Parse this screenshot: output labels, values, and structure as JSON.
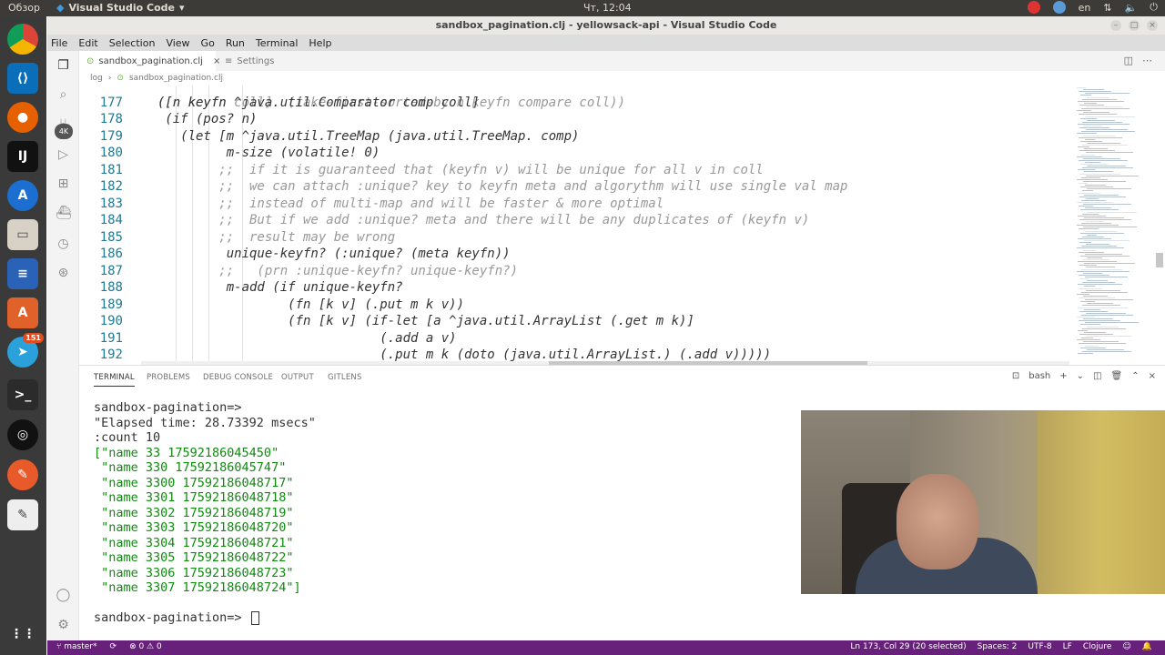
{
  "topbar": {
    "overview": "Обзор",
    "app": "Visual Studio Code",
    "clock": "Чт, 12:04",
    "lang": "en"
  },
  "window": {
    "title": "sandbox_pagination.clj - yellowsack-api - Visual Studio Code"
  },
  "menu": [
    "File",
    "Edit",
    "Selection",
    "View",
    "Go",
    "Run",
    "Terminal",
    "Help"
  ],
  "dock": {
    "telegram_badge": "151"
  },
  "tabs": [
    {
      "label": "sandbox_pagination.clj",
      "active": true
    },
    {
      "label": "Settings",
      "active": false
    }
  ],
  "breadcrumb": [
    "log",
    "sandbox_pagination.clj"
  ],
  "editor": {
    "lines": [
      {
        "n": "177",
        "t": "  ([n keyfn ^java.util.Comparator comp coll]"
      },
      {
        "n": "178",
        "t": "   (if (pos? n)"
      },
      {
        "n": "179",
        "t": "     (let [m ^java.util.TreeMap (java.util.TreeMap. comp)"
      },
      {
        "n": "180",
        "t": "           m-size (volatile! 0)"
      },
      {
        "n": "181",
        "t": "          ;;  if it is guaranteed that (keyfn v) will be unique for all v in coll"
      },
      {
        "n": "182",
        "t": "          ;;  we can attach :unique? key to keyfn meta and algorythm will use single val map"
      },
      {
        "n": "183",
        "t": "          ;;  instead of multi-map and will be faster & more optimal"
      },
      {
        "n": "184",
        "t": "          ;;  But if we add :unique? meta and there will be any duplicates of (keyfn v)"
      },
      {
        "n": "185",
        "t": "          ;;  result may be wrong"
      },
      {
        "n": "186",
        "t": "           unique-keyfn? (:unique? (meta keyfn))"
      },
      {
        "n": "187",
        "t": "          ;;   (prn :unique-keyfn? unique-keyfn?)"
      },
      {
        "n": "188",
        "t": "           m-add (if unique-keyfn?"
      },
      {
        "n": "189",
        "t": "                   (fn [k v] (.put m k v))"
      },
      {
        "n": "190",
        "t": "                   (fn [k v] (if-let [a ^java.util.ArrayList (.get m k)]"
      },
      {
        "n": "191",
        "t": "                               (.add a v)"
      },
      {
        "n": "192",
        "t": "                               (.put m k (doto (java.util.ArrayList.) (.add v)))))"
      }
    ]
  },
  "panel": {
    "tabs": [
      "TERMINAL",
      "PROBLEMS",
      "DEBUG CONSOLE",
      "OUTPUT",
      "GITLENS"
    ],
    "shell": "bash",
    "terminal_lines": [
      "sandbox-pagination=>",
      "\"Elapsed time: 28.73392 msecs\"",
      ":count 10",
      "[\"name 33 17592186045450\"",
      " \"name 330 17592186045747\"",
      " \"name 3300 17592186048717\"",
      " \"name 3301 17592186048718\"",
      " \"name 3302 17592186048719\"",
      " \"name 3303 17592186048720\"",
      " \"name 3304 17592186048721\"",
      " \"name 3305 17592186048722\"",
      " \"name 3306 17592186048723\"",
      " \"name 3307 17592186048724\"]",
      "",
      "sandbox-pagination=> "
    ]
  },
  "statusbar": {
    "branch": "master*",
    "errors": "⊗ 0 ⚠ 0",
    "position": "Ln 173, Col 29 (20 selected)",
    "spaces": "Spaces: 2",
    "encoding": "UTF-8",
    "eol": "LF",
    "language": "Clojure"
  },
  "colors": {
    "statusbar": "#68217a",
    "line_numbers": "#237893",
    "string": "#0f8a0f"
  }
}
